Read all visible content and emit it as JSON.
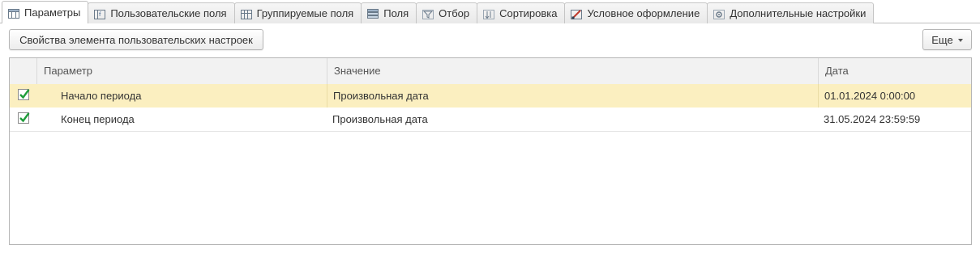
{
  "tabs": [
    {
      "label": "Параметры",
      "icon": "parameters-icon",
      "active": true
    },
    {
      "label": "Пользовательские поля",
      "icon": "custom-fields-icon",
      "active": false
    },
    {
      "label": "Группируемые поля",
      "icon": "grouping-fields-icon",
      "active": false
    },
    {
      "label": "Поля",
      "icon": "fields-icon",
      "active": false
    },
    {
      "label": "Отбор",
      "icon": "filter-icon",
      "active": false
    },
    {
      "label": "Сортировка",
      "icon": "sort-icon",
      "active": false
    },
    {
      "label": "Условное оформление",
      "icon": "conditional-format-icon",
      "active": false
    },
    {
      "label": "Дополнительные настройки",
      "icon": "additional-settings-icon",
      "active": false
    }
  ],
  "toolbar": {
    "properties_label": "Свойства элемента пользовательских настроек",
    "more_label": "Еще"
  },
  "grid": {
    "columns": [
      "Параметр",
      "Значение",
      "Дата"
    ],
    "rows": [
      {
        "checked": true,
        "selected": true,
        "parameter": "Начало периода",
        "value": "Произвольная дата",
        "date": "01.01.2024 0:00:00"
      },
      {
        "checked": true,
        "selected": false,
        "parameter": "Конец периода",
        "value": "Произвольная дата",
        "date": "31.05.2024 23:59:59"
      }
    ]
  },
  "colors": {
    "selected_row": "#fbefc0",
    "checkmark": "#1f9d3a",
    "header_bg": "#f2f2f2"
  }
}
